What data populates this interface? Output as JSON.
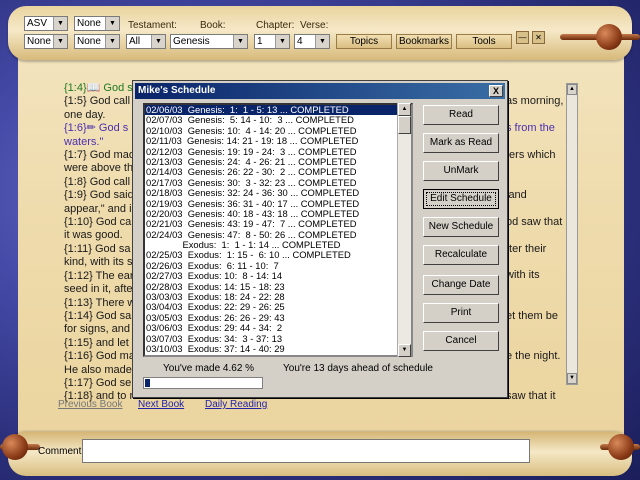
{
  "toolbar": {
    "version": "ASV",
    "none_1": "None",
    "none_2": "None",
    "none_3": "None",
    "testament_label": "Testament:",
    "testament": "All",
    "book_label": "Book:",
    "book": "Genesis",
    "chapter_label": "Chapter:",
    "chapter": "1",
    "verse_label": "Verse:",
    "verse": "4",
    "topics": "Topics",
    "bookmarks": "Bookmarks",
    "tools": "Tools",
    "minimize_glyph": "—",
    "close_glyph": "✕"
  },
  "verses_left": [
    {
      "text": "{1:4}📖 God s",
      "color": "#1f7a1f"
    },
    {
      "text": "{1:5} God call",
      "color": "#1a1a1a"
    },
    {
      "text": "one day.",
      "color": "#1a1a1a"
    },
    {
      "text": "{1:6}✏ God s",
      "color": "#4b2fb0"
    },
    {
      "text": "waters.\"",
      "color": "#4b2fb0"
    },
    {
      "text": "{1:7} God mad",
      "color": "#1a1a1a"
    },
    {
      "text": "were above th",
      "color": "#1a1a1a"
    },
    {
      "text": "{1:8} God call",
      "color": "#1a1a1a"
    },
    {
      "text": "{1:9} God said",
      "color": "#1a1a1a"
    },
    {
      "text": "appear,\" and i",
      "color": "#1a1a1a"
    },
    {
      "text": "{1:10} God ca",
      "color": "#1a1a1a"
    },
    {
      "text": "it was good.",
      "color": "#1a1a1a"
    },
    {
      "text": "{1:11} God sa",
      "color": "#1a1a1a"
    },
    {
      "text": "kind, with its s",
      "color": "#1a1a1a"
    },
    {
      "text": "{1:12} The ear",
      "color": "#1a1a1a"
    },
    {
      "text": "seed in it, afte",
      "color": "#1a1a1a"
    },
    {
      "text": "{1:13} There w",
      "color": "#1a1a1a"
    },
    {
      "text": "{1:14} God sa",
      "color": "#1a1a1a"
    },
    {
      "text": "for signs, and",
      "color": "#1a1a1a"
    },
    {
      "text": "{1:15} and let",
      "color": "#1a1a1a"
    },
    {
      "text": "{1:16} God ma",
      "color": "#1a1a1a"
    },
    {
      "text": "He also made",
      "color": "#1a1a1a"
    },
    {
      "text": "{1:17} God se",
      "color": "#1a1a1a"
    },
    {
      "text": "{1:18} and to r",
      "color": "#1a1a1a"
    }
  ],
  "verses_right": [
    {
      "text": "",
      "color": "#1a1a1a"
    },
    {
      "text": "as morning,",
      "color": "#1a1a1a"
    },
    {
      "text": "",
      "color": "#1a1a1a"
    },
    {
      "text": "s from the",
      "color": "#4b2fb0"
    },
    {
      "text": "",
      "color": "#1a1a1a"
    },
    {
      "text": "ters which",
      "color": "#1a1a1a"
    },
    {
      "text": "",
      "color": "#1a1a1a"
    },
    {
      "text": "",
      "color": "#1a1a1a"
    },
    {
      "text": "land",
      "color": "#1a1a1a"
    },
    {
      "text": "",
      "color": "#1a1a1a"
    },
    {
      "text": "od saw that",
      "color": "#1a1a1a"
    },
    {
      "text": "",
      "color": "#1a1a1a"
    },
    {
      "text": "fter their",
      "color": "#1a1a1a"
    },
    {
      "text": "",
      "color": "#1a1a1a"
    },
    {
      "text": "with its",
      "color": "#1a1a1a"
    },
    {
      "text": "",
      "color": "#1a1a1a"
    },
    {
      "text": "",
      "color": "#1a1a1a"
    },
    {
      "text": "et them be",
      "color": "#1a1a1a"
    },
    {
      "text": "",
      "color": "#1a1a1a"
    },
    {
      "text": "",
      "color": "#1a1a1a"
    },
    {
      "text": "e the night.",
      "color": "#1a1a1a"
    },
    {
      "text": "",
      "color": "#1a1a1a"
    },
    {
      "text": "",
      "color": "#1a1a1a"
    },
    {
      "text": "saw that it",
      "color": "#1a1a1a"
    }
  ],
  "nav": {
    "previous_book": "Previous Book",
    "next_book": "Next Book",
    "daily_reading": "Daily Reading"
  },
  "comment": {
    "label": "Comment:",
    "value": ""
  },
  "dialog": {
    "title": "Mike's Schedule",
    "close_glyph": "X",
    "schedule": [
      "02/06/03  Genesis:  1:  1 - 5: 13 ... COMPLETED",
      "02/07/03  Genesis:  5: 14 - 10:  3 ... COMPLETED",
      "02/10/03  Genesis: 10:  4 - 14: 20 ... COMPLETED",
      "02/11/03  Genesis: 14: 21 - 19: 18 ... COMPLETED",
      "02/12/03  Genesis: 19: 19 - 24:  3 ... COMPLETED",
      "02/13/03  Genesis: 24:  4 - 26: 21 ... COMPLETED",
      "02/14/03  Genesis: 26: 22 - 30:  2 ... COMPLETED",
      "02/17/03  Genesis: 30:  3 - 32: 23 ... COMPLETED",
      "02/18/03  Genesis: 32: 24 - 36: 30 ... COMPLETED",
      "02/19/03  Genesis: 36: 31 - 40: 17 ... COMPLETED",
      "02/20/03  Genesis: 40: 18 - 43: 18 ... COMPLETED",
      "02/21/03  Genesis: 43: 19 - 47:  7 ... COMPLETED",
      "02/24/03  Genesis: 47:  8 - 50: 26 ... COMPLETED",
      "              Exodus:  1:  1 - 1: 14 ... COMPLETED",
      "02/25/03  Exodus:  1: 15 -  6: 10 ... COMPLETED",
      "02/26/03  Exodus:  6: 11 - 10:  7",
      "02/27/03  Exodus: 10:  8 - 14: 14",
      "02/28/03  Exodus: 14: 15 - 18: 23",
      "03/03/03  Exodus: 18: 24 - 22: 28",
      "03/04/03  Exodus: 22: 29 - 26: 25",
      "03/05/03  Exodus: 26: 26 - 29: 43",
      "03/06/03  Exodus: 29: 44 - 34:  2",
      "03/07/03  Exodus: 34:  3 - 37: 13",
      "03/10/03  Exodus: 37: 14 - 40: 29"
    ],
    "selected_index": 0,
    "buttons": {
      "read": "Read",
      "mark_as_read": "Mark as Read",
      "unmark": "UnMark",
      "edit_schedule": "Edit Schedule",
      "new_schedule": "New Schedule",
      "recalculate": "Recalculate",
      "change_date": "Change Date",
      "print": "Print",
      "cancel": "Cancel"
    },
    "progress_text": "You've made 4.62 %",
    "ahead_text": "You're 13 days ahead of schedule",
    "progress_percent": 4.62
  }
}
